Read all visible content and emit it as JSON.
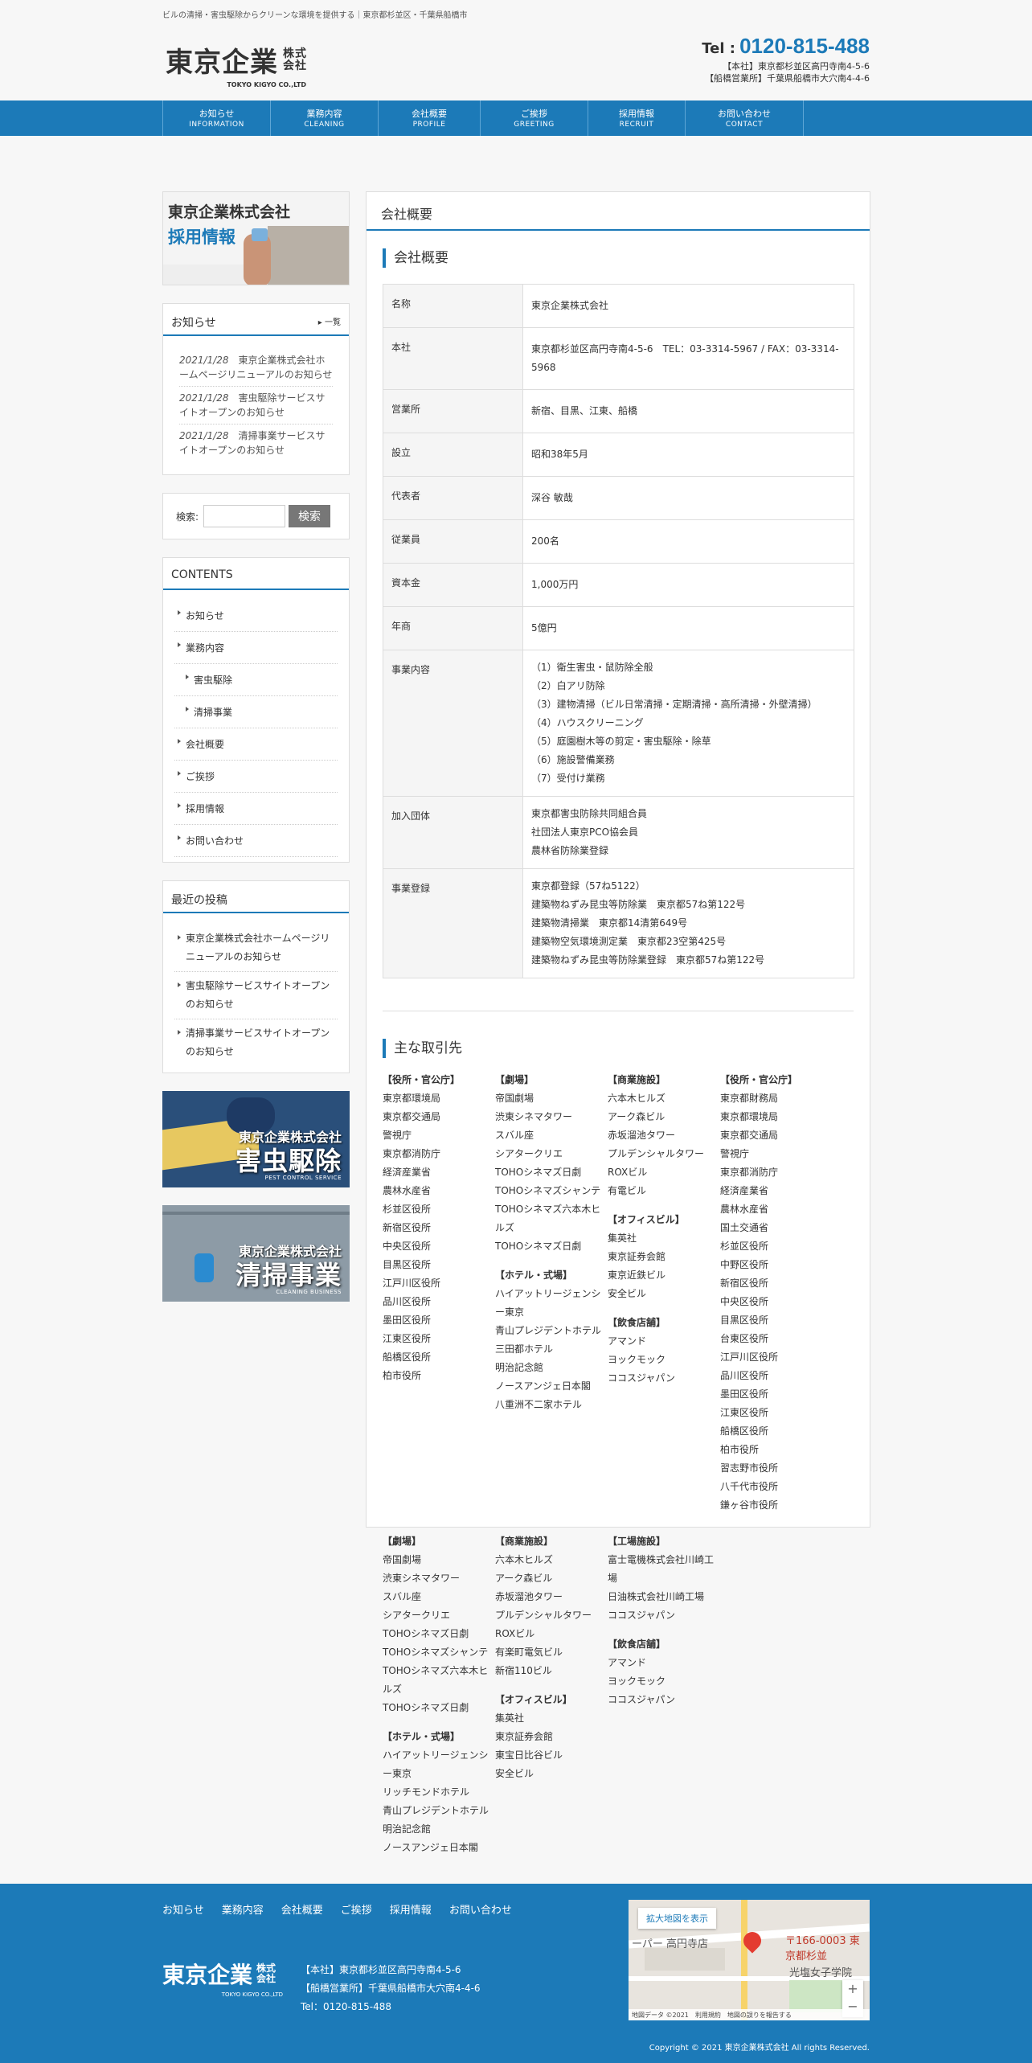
{
  "header": {
    "tagline": "ビルの清掃・害虫駆除からクリーンな環境を提供する｜東京都杉並区・千葉県船橋市",
    "logo_main": "東京企業",
    "logo_kk1": "株式",
    "logo_kk2": "会社",
    "logo_en": "TOKYO KIGYO CO.,LTD",
    "tel_label": "Tel :",
    "tel_number": "0120-815-488",
    "address_main": "【本社】東京都杉並区高円寺南4-5-6",
    "address_branch": "【船橋営業所】千葉県船橋市大穴南4-4-6"
  },
  "nav": [
    {
      "jp": "お知らせ",
      "en": "INFORMATION"
    },
    {
      "jp": "業務内容",
      "en": "CLEANING"
    },
    {
      "jp": "会社概要",
      "en": "PROFILE"
    },
    {
      "jp": "ご挨拶",
      "en": "GREETING"
    },
    {
      "jp": "採用情報",
      "en": "RECRUIT"
    },
    {
      "jp": "お問い合わせ",
      "en": "CONTACT"
    }
  ],
  "sidebar": {
    "recruit_banner": {
      "line1": "東京企業株式会社",
      "line2": "採用情報"
    },
    "news": {
      "title": "お知らせ",
      "more": "一覧",
      "items": [
        {
          "date": "2021/1/28",
          "text": "東京企業株式会社ホームページリニューアルのお知らせ"
        },
        {
          "date": "2021/1/28",
          "text": "害虫駆除サービスサイトオープンのお知らせ"
        },
        {
          "date": "2021/1/28",
          "text": "清掃事業サービスサイトオープンのお知らせ"
        }
      ]
    },
    "search": {
      "label": "検索:",
      "button": "検索",
      "placeholder": ""
    },
    "contents": {
      "title": "CONTENTS",
      "items": [
        "お知らせ",
        "業務内容",
        "害虫駆除",
        "清掃事業",
        "会社概要",
        "ご挨拶",
        "採用情報",
        "お問い合わせ"
      ]
    },
    "recent": {
      "title": "最近の投稿",
      "items": [
        "東京企業株式会社ホームページリニューアルのお知らせ",
        "害虫駆除サービスサイトオープンのお知らせ",
        "清掃事業サービスサイトオープンのお知らせ"
      ]
    },
    "pest_banner": {
      "line1": "東京企業株式会社",
      "line2": "害虫駆除",
      "line3": "PEST CONTROL SERVICE"
    },
    "clean_banner": {
      "line1": "東京企業株式会社",
      "line2": "清掃事業",
      "line3": "CLEANING BUSINESS"
    }
  },
  "main": {
    "page_title": "会社概要",
    "profile_heading": "会社概要",
    "rows": [
      {
        "label": "名称",
        "value": [
          "東京企業株式会社"
        ]
      },
      {
        "label": "本社",
        "value": [
          "東京都杉並区高円寺南4-5-6　TEL：03-3314-5967 / FAX：03-3314-5968"
        ]
      },
      {
        "label": "営業所",
        "value": [
          "新宿、目黒、江東、船橋"
        ]
      },
      {
        "label": "設立",
        "value": [
          "昭和38年5月"
        ]
      },
      {
        "label": "代表者",
        "value": [
          "深谷 敏哉"
        ]
      },
      {
        "label": "従業員",
        "value": [
          "200名"
        ]
      },
      {
        "label": "資本金",
        "value": [
          "1,000万円"
        ]
      },
      {
        "label": "年商",
        "value": [
          "5億円"
        ]
      },
      {
        "label": "事業内容",
        "value": [
          "（1）衛生害虫・鼠防除全般",
          "（2）白アリ防除",
          "（3）建物清掃（ビル日常清掃・定期清掃・高所清掃・外壁清掃）",
          "（4）ハウスクリーニング",
          "（5）庭園樹木等の剪定・害虫駆除・除草",
          "（6）施設警備業務",
          "（7）受付け業務"
        ]
      },
      {
        "label": "加入団体",
        "value": [
          "東京都害虫防除共同組合員",
          "社団法人東京PCO協会員",
          "農林省防除業登録"
        ]
      },
      {
        "label": "事業登録",
        "value": [
          "東京都登録（57ね5122）",
          "建築物ねずみ昆虫等防除業　東京都57ね第122号",
          "建築物清掃業　東京都14清第649号",
          "建築物空気環境測定業　東京都23空第425号",
          "建築物ねずみ昆虫等防除業登録　東京都57ね第122号"
        ]
      }
    ],
    "clients_heading": "主な取引先",
    "clients_top": [
      [
        {
          "h": "【役所・官公庁】",
          "items": [
            "東京都環境局",
            "東京都交通局",
            "警視庁",
            "東京都消防庁",
            "経済産業省",
            "農林水産省",
            "杉並区役所",
            "新宿区役所",
            "中央区役所",
            "目黒区役所",
            "江戸川区役所",
            "品川区役所",
            "墨田区役所",
            "江東区役所",
            "船橋区役所",
            "柏市役所"
          ]
        }
      ],
      [
        {
          "h": "【劇場】",
          "items": [
            "帝国劇場",
            "渋東シネマタワー",
            "スバル座",
            "シアタークリエ",
            "TOHOシネマズ日劇",
            "TOHOシネマズシャンテ",
            "TOHOシネマズ六本木ヒルズ",
            "TOHOシネマズ日劇"
          ]
        },
        {
          "h": "【ホテル・式場】",
          "items": [
            "ハイアットリージェンシー東京",
            "青山プレジデントホテル",
            "三田都ホテル",
            "明治記念館",
            "ノースアンジェ日本閣",
            "八重洲不二家ホテル"
          ]
        }
      ],
      [
        {
          "h": "【商業施設】",
          "items": [
            "六本木ヒルズ",
            "アーク森ビル",
            "赤坂溜池タワー",
            "プルデンシャルタワー",
            "ROXビル",
            "有電ビル"
          ]
        },
        {
          "h": "【オフィスビル】",
          "items": [
            "集英社",
            "東京証券会館",
            "東京近鉄ビル",
            "安全ビル"
          ]
        },
        {
          "h": "【飲食店舗】",
          "items": [
            "アマンド",
            "ヨックモック",
            "ココスジャパン"
          ]
        }
      ],
      [
        {
          "h": "【役所・官公庁】",
          "items": [
            "東京都財務局",
            "東京都環境局",
            "東京都交通局",
            "警視庁",
            "東京都消防庁",
            "経済産業省",
            "農林水産省",
            "国土交通省",
            "杉並区役所",
            "中野区役所",
            "新宿区役所",
            "中央区役所",
            "目黒区役所",
            "台東区役所",
            "江戸川区役所",
            "品川区役所",
            "墨田区役所",
            "江東区役所",
            "船橋区役所",
            "柏市役所",
            "習志野市役所",
            "八千代市役所",
            "鎌ヶ谷市役所"
          ]
        }
      ]
    ],
    "clients_bottom": [
      [
        {
          "h": "【劇場】",
          "items": [
            "帝国劇場",
            "渋東シネマタワー",
            "スバル座",
            "シアタークリエ",
            "TOHOシネマズ日劇",
            "TOHOシネマズシャンテ",
            "TOHOシネマズ六本木ヒルズ",
            "TOHOシネマズ日劇"
          ]
        },
        {
          "h": "【ホテル・式場】",
          "items": [
            "ハイアットリージェンシー東京",
            "リッチモンドホテル",
            "青山プレジデントホテル",
            "明治記念館",
            "ノースアンジェ日本閣"
          ]
        }
      ],
      [
        {
          "h": "【商業施設】",
          "items": [
            "六本木ヒルズ",
            "アーク森ビル",
            "赤坂溜池タワー",
            "プルデンシャルタワー",
            "ROXビル",
            "有楽町電気ビル",
            "新宿110ビル"
          ]
        },
        {
          "h": "【オフィスビル】",
          "items": [
            "集英社",
            "東京証券会館",
            "東宝日比谷ビル",
            "安全ビル"
          ]
        }
      ],
      [
        {
          "h": "【工場施設】",
          "items": [
            "富士電機株式会社川崎工場",
            "日油株式会社川崎工場",
            "ココスジャパン"
          ]
        },
        {
          "h": "【飲食店舗】",
          "items": [
            "アマンド",
            "ヨックモック",
            "ココスジャパン"
          ]
        }
      ]
    ]
  },
  "footer": {
    "nav": [
      "お知らせ",
      "業務内容",
      "会社概要",
      "ご挨拶",
      "採用情報",
      "お問い合わせ"
    ],
    "logo_main": "東京企業",
    "logo_kk1": "株式",
    "logo_kk2": "会社",
    "logo_en": "TOKYO KIGYO CO.,LTD",
    "address_main": "【本社】東京都杉並区高円寺南4-5-6",
    "address_branch": "【船橋営業所】千葉県船橋市大穴南4-4-6",
    "tel": "Tel：0120-815-488",
    "map": {
      "enlarge": "拡大地図を表示",
      "place": "〒166-0003 東京都杉並",
      "label1": "ーパー 高円寺店",
      "label2": "光塩女子学院",
      "attribution": "地図データ ©2021　利用規約　地図の誤りを報告する"
    },
    "copyright": "Copyright © 2021 東京企業株式会社 All rights Reserved."
  },
  "colors": {
    "accent": "#1c7ab8",
    "background": "#f7f7f7"
  }
}
